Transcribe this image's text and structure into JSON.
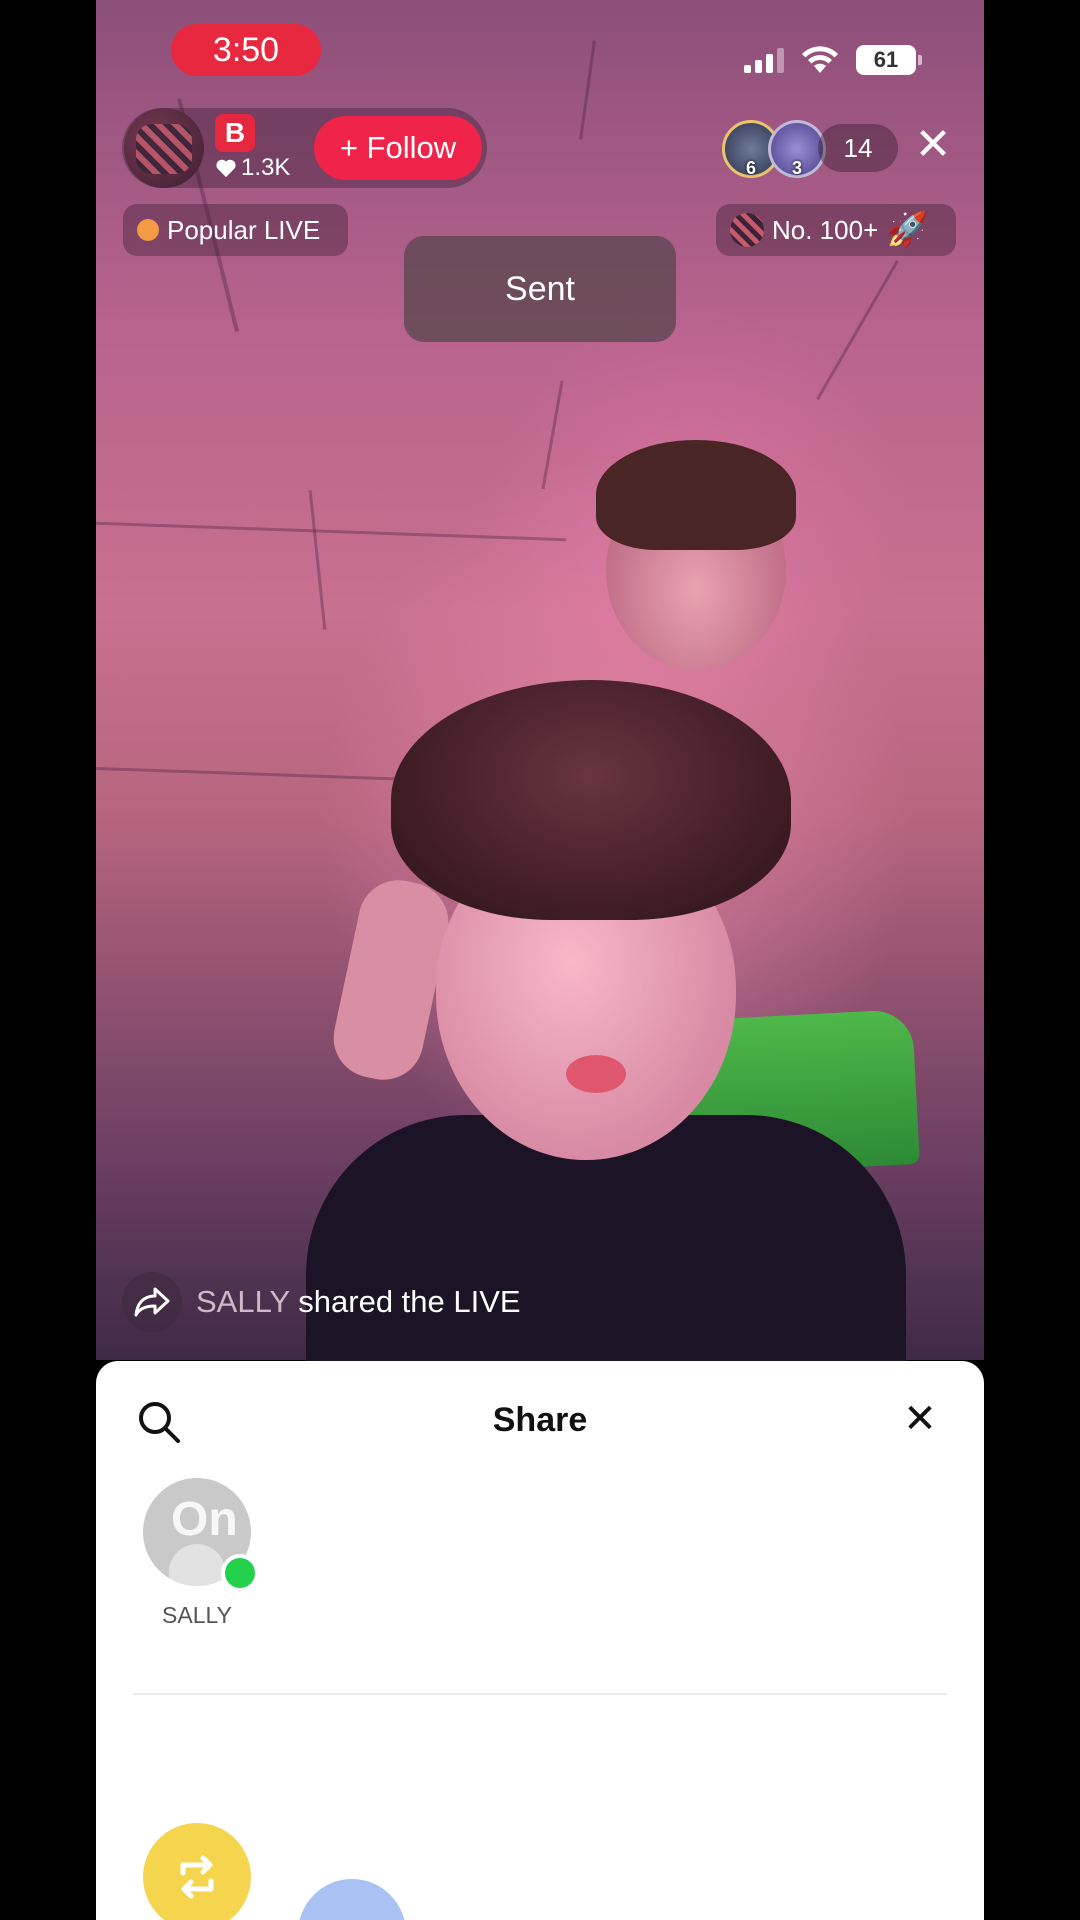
{
  "status_bar": {
    "time": "3:50",
    "battery": "61",
    "colors": {
      "time_pill": "#e8283f"
    }
  },
  "host": {
    "badge": "B",
    "likes": "1.3K",
    "follow_label": "+ Follow",
    "colors": {
      "follow": "#f0244a"
    }
  },
  "viewers": {
    "avatar1_num": "6",
    "avatar2_num": "3",
    "count": "14"
  },
  "tags": {
    "popular": "Popular LIVE",
    "rank": "No. 100+"
  },
  "toast": {
    "text": "Sent"
  },
  "share_notice": {
    "name": "SALLY",
    "text": "shared the LIVE"
  },
  "share_sheet": {
    "title": "Share",
    "contacts": [
      {
        "name": "SALLY",
        "online": true
      }
    ],
    "icons": {
      "search": "search-icon",
      "close": "close-icon",
      "repost": "repost-icon"
    },
    "colors": {
      "online": "#23d14c",
      "repost": "#f5d54e",
      "other": "#a9c2f3"
    }
  }
}
